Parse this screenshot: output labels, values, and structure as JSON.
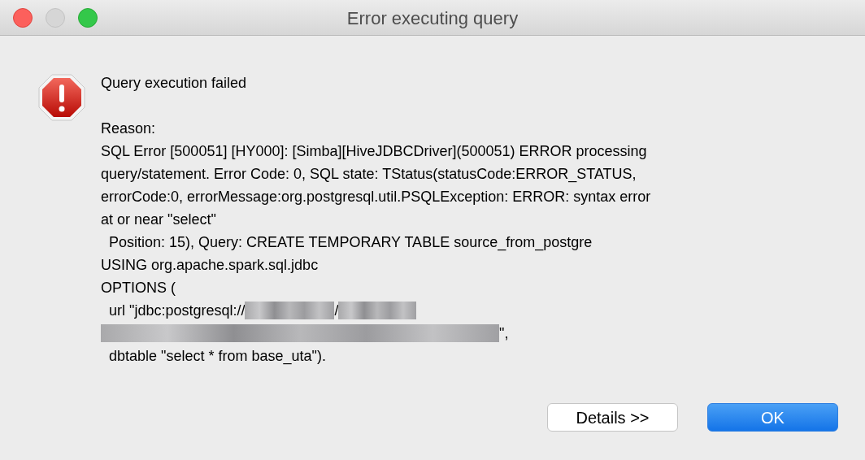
{
  "window": {
    "title": "Error executing query"
  },
  "message": {
    "heading": "Query execution failed",
    "lines": [
      [
        {
          "kind": "text",
          "text": "Reason:"
        }
      ],
      [
        {
          "kind": "text",
          "text": "SQL Error [500051] [HY000]: [Simba][HiveJDBCDriver](500051) ERROR processing"
        }
      ],
      [
        {
          "kind": "text",
          "text": "query/statement. Error Code: 0, SQL state: TStatus(statusCode:ERROR_STATUS,"
        }
      ],
      [
        {
          "kind": "text",
          "text": "errorCode:0, errorMessage:org.postgresql.util.PSQLException: ERROR: syntax error"
        }
      ],
      [
        {
          "kind": "text",
          "text": "at or near \"select\""
        }
      ],
      [
        {
          "kind": "text",
          "text": "  Position: 15), Query: CREATE TEMPORARY TABLE source_from_postgre"
        }
      ],
      [
        {
          "kind": "text",
          "text": "USING org.apache.spark.sql.jdbc"
        }
      ],
      [
        {
          "kind": "text",
          "text": "OPTIONS ("
        }
      ],
      [
        {
          "kind": "text",
          "text": "  url \"jdbc:postgresql://"
        },
        {
          "kind": "redacted"
        },
        {
          "kind": "text",
          "text": "/"
        },
        {
          "kind": "redacted"
        }
      ],
      [
        {
          "kind": "redacted"
        },
        {
          "kind": "text",
          "text": "\","
        }
      ],
      [
        {
          "kind": "text",
          "text": "  dbtable \"select * from base_uta\")."
        }
      ]
    ]
  },
  "buttons": [
    {
      "label": "Details >>",
      "default": false
    },
    {
      "label": "OK",
      "default": true
    }
  ]
}
